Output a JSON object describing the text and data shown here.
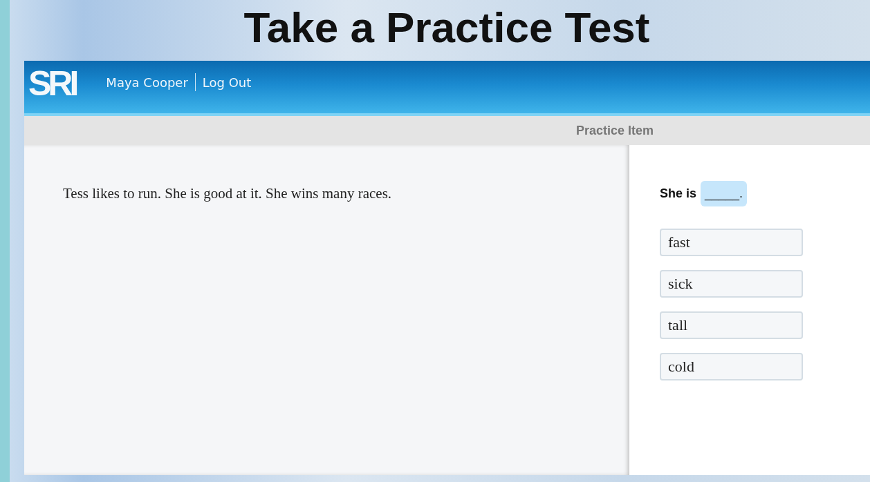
{
  "slide_title": "Take a Practice Test",
  "header": {
    "logo": "SRI",
    "user_name": "Maya Cooper",
    "logout": "Log Out"
  },
  "toolbar": {
    "title": "Practice Item"
  },
  "passage": "Tess likes to run. She is good at it. She wins many races.",
  "question": {
    "prefix": "She is",
    "blank": "_____."
  },
  "options": [
    {
      "label": "fast"
    },
    {
      "label": "sick"
    },
    {
      "label": "tall"
    },
    {
      "label": "cold"
    }
  ]
}
